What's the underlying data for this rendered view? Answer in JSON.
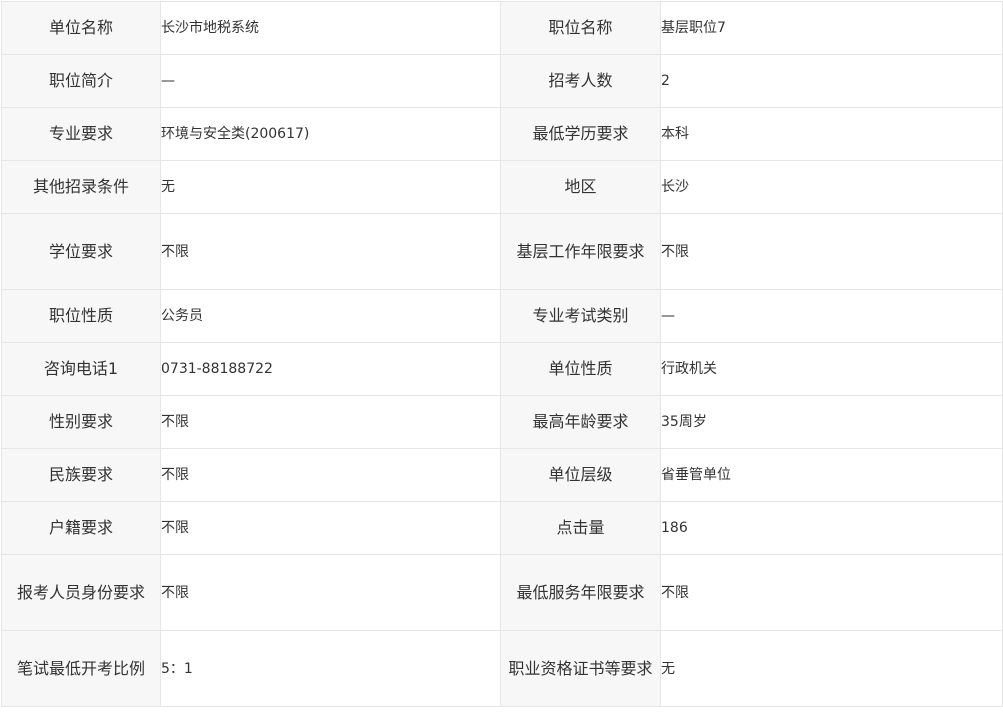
{
  "rows": [
    {
      "l1": "单位名称",
      "v1": "长沙市地税系统",
      "l2": "职位名称",
      "v2": "基层职位7"
    },
    {
      "l1": "职位简介",
      "v1": "—",
      "l2": "招考人数",
      "v2": "2"
    },
    {
      "l1": "专业要求",
      "v1": "环境与安全类(200617)",
      "l2": "最低学历要求",
      "v2": "本科"
    },
    {
      "l1": "其他招录条件",
      "v1": "无",
      "l2": "地区",
      "v2": "长沙"
    },
    {
      "l1": "学位要求",
      "v1": "不限",
      "l2": "基层工作年限要求",
      "v2": "不限"
    },
    {
      "l1": "职位性质",
      "v1": "公务员",
      "l2": "专业考试类别",
      "v2": "—"
    },
    {
      "l1": "咨询电话1",
      "v1": "0731-88188722",
      "l2": "单位性质",
      "v2": "行政机关"
    },
    {
      "l1": "性别要求",
      "v1": "不限",
      "l2": "最高年龄要求",
      "v2": "35周岁"
    },
    {
      "l1": "民族要求",
      "v1": "不限",
      "l2": "单位层级",
      "v2": "省垂管单位"
    },
    {
      "l1": "户籍要求",
      "v1": "不限",
      "l2": "点击量",
      "v2": "186"
    },
    {
      "l1": "报考人员身份要求",
      "v1": "不限",
      "l2": "最低服务年限要求",
      "v2": "不限"
    },
    {
      "l1": "笔试最低开考比例",
      "v1": "5：1",
      "l2": "职业资格证书等要求",
      "v2": "无"
    }
  ]
}
